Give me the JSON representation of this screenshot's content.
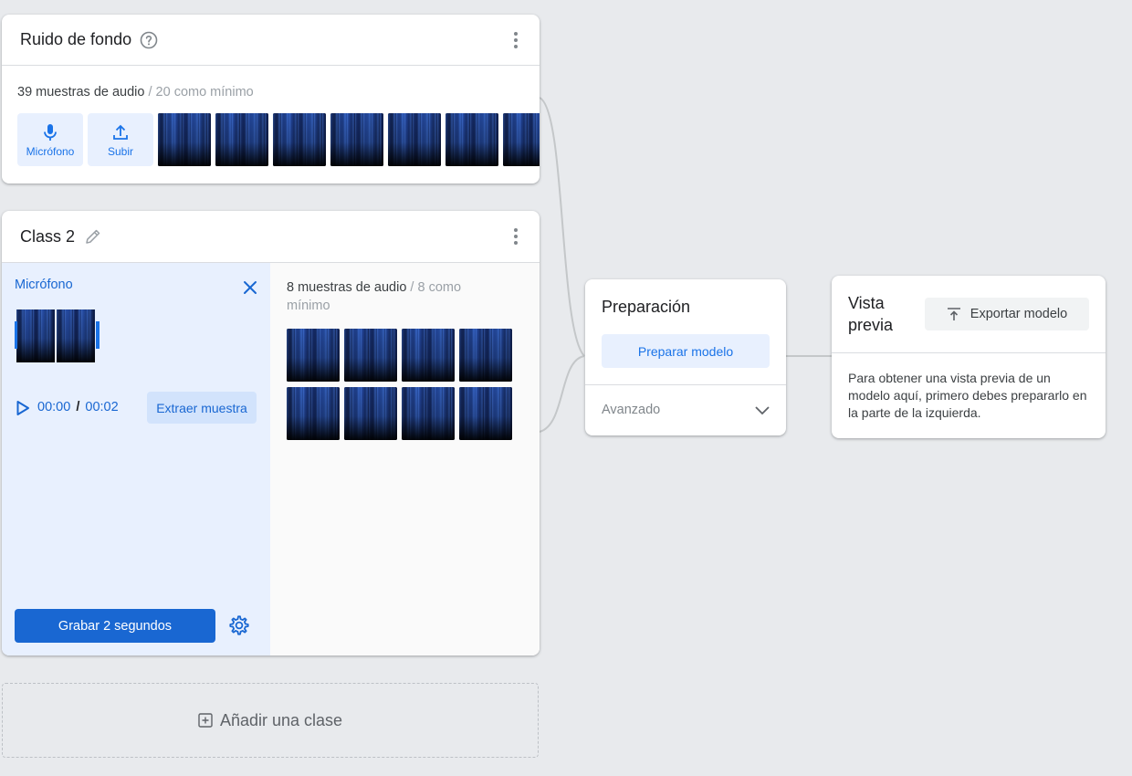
{
  "background_card": {
    "title": "Ruido de fondo",
    "sample_count": "39 muestras de audio",
    "sample_min": "/ 20 como mínimo",
    "mic_label": "Micrófono",
    "upload_label": "Subir"
  },
  "class2_card": {
    "title": "Class 2",
    "mic_panel": {
      "title": "Micrófono",
      "time_current": "00:00",
      "time_separator": "/",
      "time_total": "00:02",
      "extract_label": "Extraer muestra",
      "record_label": "Grabar 2 segundos"
    },
    "sample_count": "8 muestras de audio",
    "sample_min": "/ 8 como mínimo"
  },
  "add_class_label": "Añadir una clase",
  "training_card": {
    "title": "Preparación",
    "train_button": "Preparar modelo",
    "advanced_label": "Avanzado"
  },
  "preview_card": {
    "title": "Vista previa",
    "export_button": "Exportar modelo",
    "message": "Para obtener una vista previa de un modelo aquí, primero debes prepararlo en la parte de la izquierda."
  },
  "colors": {
    "accent": "#1a73e8",
    "primary_button": "#1967d2",
    "panel_background": "#e8f0fe",
    "page_background": "#e8eaed"
  },
  "icons": [
    "help-icon",
    "kebab-menu-icon",
    "microphone-icon",
    "upload-icon",
    "pencil-icon",
    "close-icon",
    "play-icon",
    "settings-gear-icon",
    "chevron-down-icon",
    "export-icon",
    "add-box-icon"
  ]
}
